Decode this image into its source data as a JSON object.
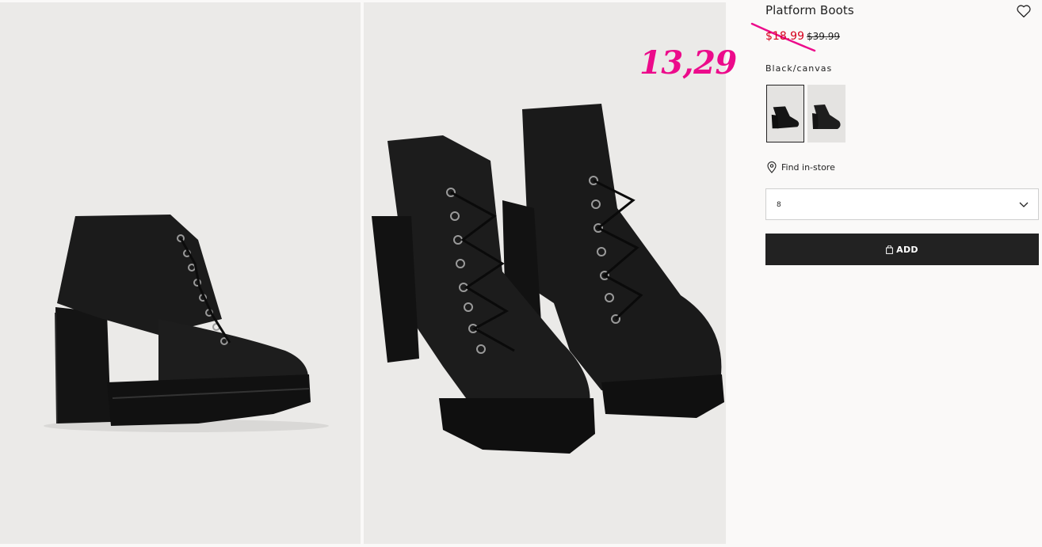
{
  "product": {
    "title": "Platform Boots",
    "sale_price": "$18.99",
    "original_price": "$39.99",
    "color_name": "Black/canvas",
    "swatches": [
      {
        "name": "black-canvas",
        "selected": true
      },
      {
        "name": "black-alt",
        "selected": false
      }
    ]
  },
  "annotation": {
    "handwritten_price": "13,29",
    "color": "#ec0b8b"
  },
  "store": {
    "find_label": "Find in-store",
    "icon": "map-pin-icon"
  },
  "size_select": {
    "value": "8",
    "icon": "chevron-down-icon"
  },
  "add_button": {
    "label": "ADD",
    "icon": "shopping-bag-icon"
  },
  "wishlist": {
    "icon": "heart-icon"
  },
  "colors": {
    "sale": "#d6001c",
    "button_bg": "#222222",
    "photo_bg": "#ebeae8",
    "panel_bg": "#faf9f8"
  }
}
